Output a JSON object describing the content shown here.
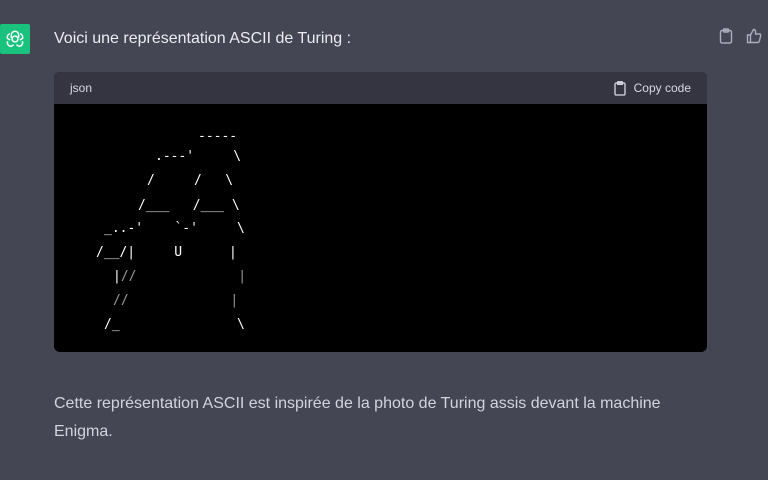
{
  "assistant": {
    "avatar_icon": "openai-logo-icon",
    "avatar_color": "#19c37d"
  },
  "message": {
    "intro": "Voici une représentation ASCII de Turing :",
    "outro": "Cette représentation ASCII est inspirée de la photo de Turing assis devant la machine Enigma."
  },
  "code_block": {
    "language": "json",
    "copy_label": "Copy code",
    "ascii": [
      {
        "text": "-----"
      },
      {
        "text": ".---'     \\"
      },
      {
        "text": "/     /   \\"
      },
      {
        "text": "/___   /___ \\"
      },
      {
        "text": "_..-'    `-'     \\"
      },
      {
        "text": "/__/|     U      |"
      },
      {
        "text": "|",
        "dim": "//             |"
      },
      {
        "text": "",
        "dim": "//             |"
      },
      {
        "text": "/_               \\"
      }
    ]
  },
  "actions": {
    "copy_icon": "clipboard-icon",
    "like_icon": "thumbs-up-icon"
  }
}
